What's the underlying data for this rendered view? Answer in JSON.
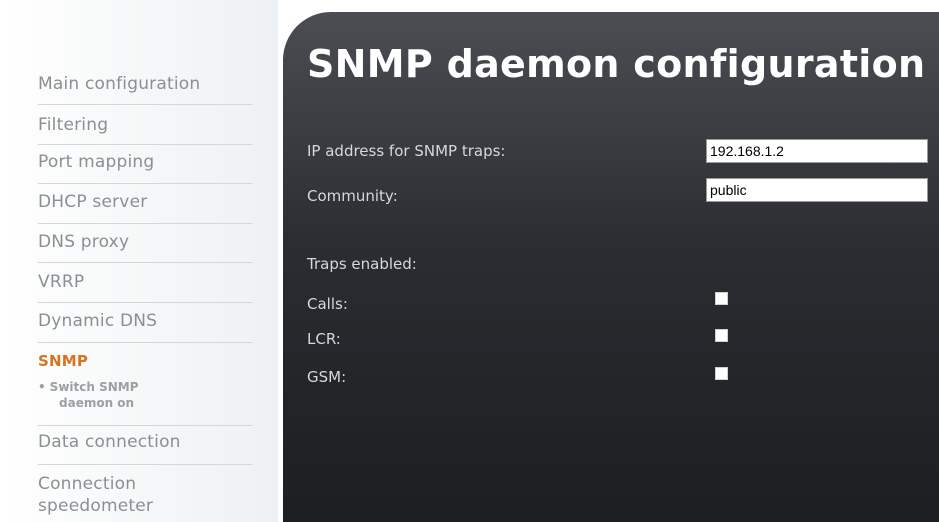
{
  "sidebar": {
    "items": [
      {
        "label": "Main configuration"
      },
      {
        "label": "Filtering"
      },
      {
        "label": "Port mapping"
      },
      {
        "label": "DHCP server"
      },
      {
        "label": "DNS proxy"
      },
      {
        "label": "VRRP"
      },
      {
        "label": "Dynamic DNS"
      },
      {
        "label": "SNMP",
        "active": true
      },
      {
        "label": "Data connection"
      },
      {
        "label": "Connection speedometer"
      }
    ],
    "sub_item": {
      "bullet": "•",
      "line1": "Switch SNMP",
      "line2": "daemon on"
    },
    "connection_line1": "Connection",
    "connection_line2": "speedometer"
  },
  "main": {
    "title": "SNMP daemon configuration",
    "ip_label": "IP address for SNMP traps:",
    "ip_value": "192.168.1.2",
    "community_label": "Community:",
    "community_value": "public",
    "traps_heading": "Traps enabled:",
    "traps": [
      {
        "label": "Calls:",
        "checked": false
      },
      {
        "label": "LCR:",
        "checked": false
      },
      {
        "label": "GSM:",
        "checked": false
      }
    ]
  },
  "colors": {
    "accent": "#d9731f",
    "sidebar_text": "#8a8f93",
    "panel_dark": "#1c1e21"
  }
}
